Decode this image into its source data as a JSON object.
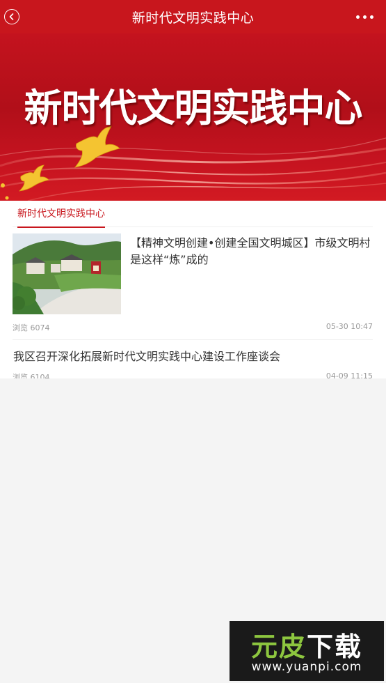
{
  "header": {
    "title": "新时代文明实践中心"
  },
  "banner": {
    "text": "新时代文明实践中心"
  },
  "tabs": [
    {
      "label": "新时代文明实践中心",
      "active": true
    }
  ],
  "articles": [
    {
      "title": "【精神文明创建•创建全国文明城区】市级文明村是这样“炼”成的",
      "views": "浏览 6074",
      "date": "05-30 10:47",
      "has_thumbnail": true
    },
    {
      "title": "我区召开深化拓展新时代文明实践中心建设工作座谈会",
      "views": "浏览 6104",
      "date": "04-09 11:15",
      "has_thumbnail": false
    }
  ],
  "watermark": {
    "text_part1": "元皮",
    "text_part2": "下载",
    "url": "www.yuanpi.com"
  },
  "colors": {
    "accent": "#c8161d"
  }
}
